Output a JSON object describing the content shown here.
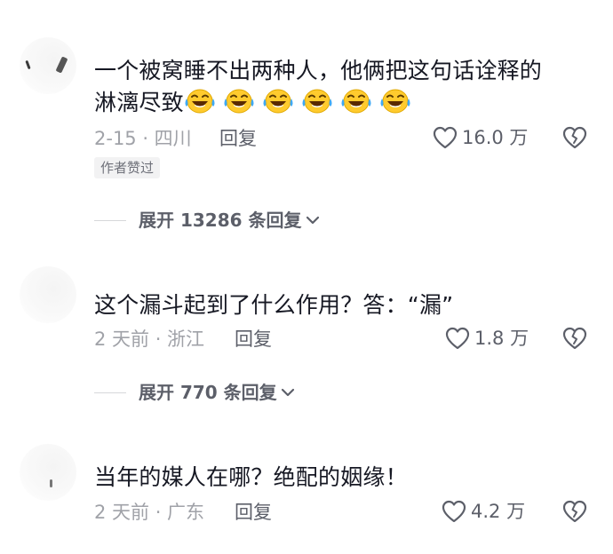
{
  "comments": [
    {
      "text_line1": "一个被窝睡不出两种人，他俩把这句话诠释的",
      "text_line2": "淋漓尽致",
      "emoji_icon": "tears-of-joy-emoji",
      "emoji_count": 6,
      "date_location": "2-15 · 四川",
      "reply_label": "回复",
      "likes": "16.0 万",
      "badge": "作者赞过",
      "expand_label": "展开 13286 条回复"
    },
    {
      "text_line1": "这个漏斗起到了什么作用？答：“漏”",
      "date_location": "2 天前 · 浙江",
      "reply_label": "回复",
      "likes": "1.8 万",
      "expand_label": "展开 770 条回复"
    },
    {
      "text_line1": "当年的媒人在哪？绝配的姻缘！",
      "date_location": "2 天前 · 广东",
      "reply_label": "回复",
      "likes": "4.2 万"
    }
  ],
  "colors": {
    "text_primary": "#161823",
    "text_secondary": "#a0a2a8",
    "text_action": "#5c5f69",
    "badge_bg": "#f2f2f3",
    "emoji_yellow": "#ffcb2e",
    "emoji_tear": "#3fa9f5"
  }
}
